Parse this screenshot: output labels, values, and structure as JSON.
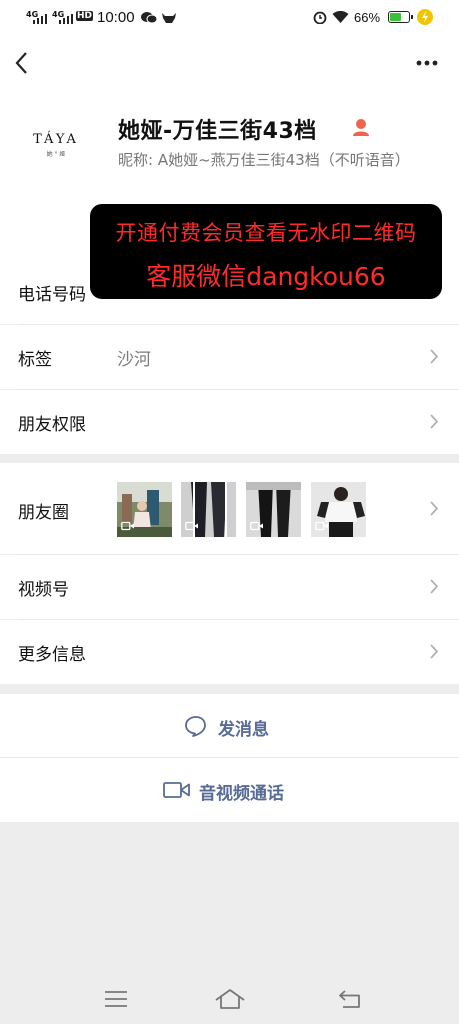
{
  "status": {
    "signal1": "4G",
    "signal2": "4G",
    "hd": "HD",
    "time": "10:00",
    "battery": "66%",
    "battery_level": 0.66
  },
  "profile": {
    "name": "她娅-万佳三街43档",
    "nickname_label": "昵称:",
    "nickname": "A她娅~燕万佳三街43档（不听语音）",
    "avatar_brand": "TÁYA",
    "avatar_sub": "她 ° 娅"
  },
  "overlay": {
    "line1": "开通付费会员查看无水印二维码",
    "line2": "客服微信dangkou66"
  },
  "rows": {
    "phone_label": "电话号码",
    "tags_label": "标签",
    "tags_value": "沙河",
    "permissions_label": "朋友权限",
    "moments_label": "朋友圈",
    "channels_label": "视频号",
    "more_label": "更多信息"
  },
  "actions": {
    "message": "发消息",
    "call": "音视频通话"
  },
  "colors": {
    "link": "#576b95",
    "overlay_text": "#ff2b2b",
    "battery": "#39c13a"
  }
}
